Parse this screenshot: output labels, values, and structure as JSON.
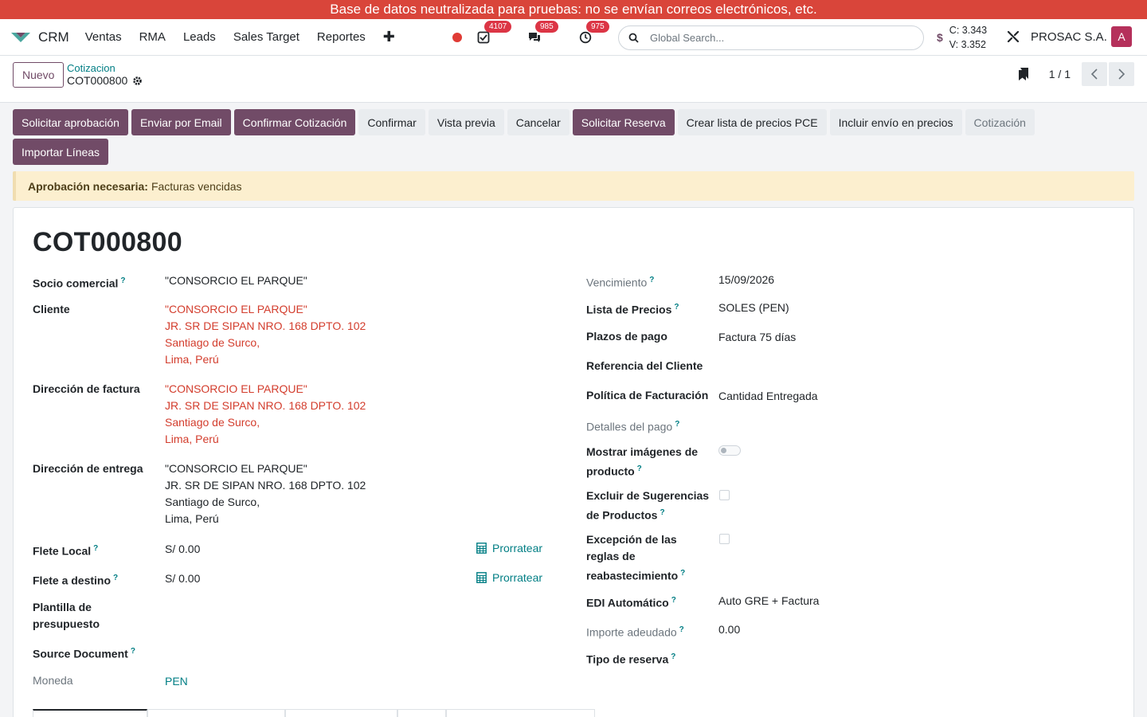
{
  "banner": "Base de datos neutralizada para pruebas: no se envían correos electrónicos, etc.",
  "navbar": {
    "app_name": "CRM",
    "menu": [
      "Ventas",
      "RMA",
      "Leads",
      "Sales Target",
      "Reportes"
    ],
    "badges": {
      "activities": "4107",
      "messages": "985",
      "clock": "975"
    },
    "search_placeholder": "Global Search...",
    "rates": {
      "c": "C: 3.343",
      "v": "V: 3.352"
    },
    "company": "PROSAC S.A.",
    "avatar": "A"
  },
  "control": {
    "new_label": "Nuevo",
    "breadcrumb_parent": "Cotizacion",
    "breadcrumb_current": "COT000800",
    "pager": "1 / 1"
  },
  "actions": {
    "row1": [
      {
        "label": "Solicitar aprobación",
        "style": "primary"
      },
      {
        "label": "Enviar por Email",
        "style": "primary"
      },
      {
        "label": "Confirmar Cotización",
        "style": "primary"
      },
      {
        "label": "Confirmar",
        "style": "secondary"
      },
      {
        "label": "Vista previa",
        "style": "secondary"
      },
      {
        "label": "Cancelar",
        "style": "secondary"
      },
      {
        "label": "Solicitar Reserva",
        "style": "primary"
      },
      {
        "label": "Crear lista de precios PCE",
        "style": "secondary"
      },
      {
        "label": "Incluir envío en precios",
        "style": "secondary"
      },
      {
        "label": "Cotización",
        "style": "stage"
      }
    ],
    "row2_label": "Importar Líneas"
  },
  "alert": {
    "bold": "Aprobación necesaria:",
    "text": "Facturas vencidas"
  },
  "form": {
    "title": "COT000800",
    "left": {
      "partner": {
        "label": "Socio comercial",
        "value": "\"CONSORCIO EL PARQUE\""
      },
      "client": {
        "label": "Cliente",
        "lines": [
          "\"CONSORCIO EL PARQUE\"",
          "JR. SR DE SIPAN NRO. 168 DPTO. 102",
          "Santiago de Surco,",
          "Lima, Perú"
        ]
      },
      "invoice_address": {
        "label": "Dirección de factura",
        "lines": [
          "\"CONSORCIO EL PARQUE\"",
          "JR. SR DE SIPAN NRO. 168 DPTO. 102",
          "Santiago de Surco,",
          "Lima, Perú"
        ]
      },
      "delivery_address": {
        "label": "Dirección de entrega",
        "lines": [
          "\"CONSORCIO EL PARQUE\"",
          "JR. SR DE SIPAN NRO. 168 DPTO. 102",
          "Santiago de Surco,",
          "Lima, Perú"
        ]
      },
      "local_freight": {
        "label": "Flete Local",
        "value": "S/ 0.00",
        "action": "Prorratear"
      },
      "dest_freight": {
        "label": "Flete a destino",
        "value": "S/ 0.00",
        "action": "Prorratear"
      },
      "template": {
        "label_1": "Plantilla de",
        "label_2": "presupuesto"
      },
      "source": {
        "label": "Source Document"
      },
      "currency": {
        "label": "Moneda",
        "value": "PEN"
      }
    },
    "right": {
      "expiry": {
        "label": "Vencimiento",
        "value": "15/09/2026"
      },
      "pricelist": {
        "label": "Lista de Precios",
        "value": "SOLES (PEN)"
      },
      "payment_terms": {
        "label": "Plazos de pago",
        "value": "Factura 75 días"
      },
      "client_ref": {
        "label": "Referencia del Cliente"
      },
      "invoice_policy": {
        "label": "Política de Facturación",
        "value": "Cantidad Entregada"
      },
      "payment_details": {
        "label": "Detalles del pago"
      },
      "show_images": {
        "label_1": "Mostrar imágenes de",
        "label_2": "producto"
      },
      "exclude_suggestions": {
        "label_1": "Excluir de Sugerencias",
        "label_2": "de Productos"
      },
      "replenish_exception": {
        "label_1": "Excepción de las",
        "label_2": "reglas de",
        "label_3": "reabastecimiento"
      },
      "edi": {
        "label": "EDI Automático",
        "value": "Auto GRE + Factura"
      },
      "amount_due": {
        "label": "Importe adeudado",
        "value": "0.00"
      },
      "reservation_type": {
        "label": "Tipo de reserva"
      }
    }
  },
  "colors": {
    "primary": "#714b67",
    "teal": "#017e84",
    "banner": "#d9453a",
    "address_red": "#d33d2d"
  }
}
